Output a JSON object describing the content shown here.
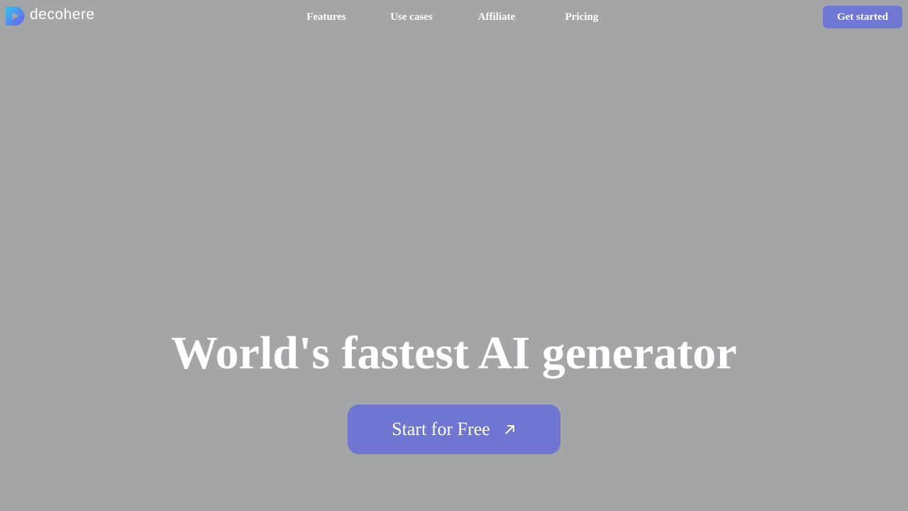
{
  "brand": {
    "name": "decohere",
    "logo_icon": "decohere-logo-icon",
    "gradient_colors": [
      "#35c4e8",
      "#6a5cf0"
    ]
  },
  "nav": {
    "links": [
      {
        "label": "Features"
      },
      {
        "label": "Use cases"
      },
      {
        "label": "Affiliate"
      },
      {
        "label": "Pricing"
      }
    ],
    "cta_label": "Get started"
  },
  "hero": {
    "title": "World's fastest AI generator",
    "cta_label": "Start for Free",
    "cta_icon": "arrow-up-right-icon"
  },
  "colors": {
    "background": "#a4a5a7",
    "accent": "#6f76d3",
    "text": "#ffffff"
  }
}
